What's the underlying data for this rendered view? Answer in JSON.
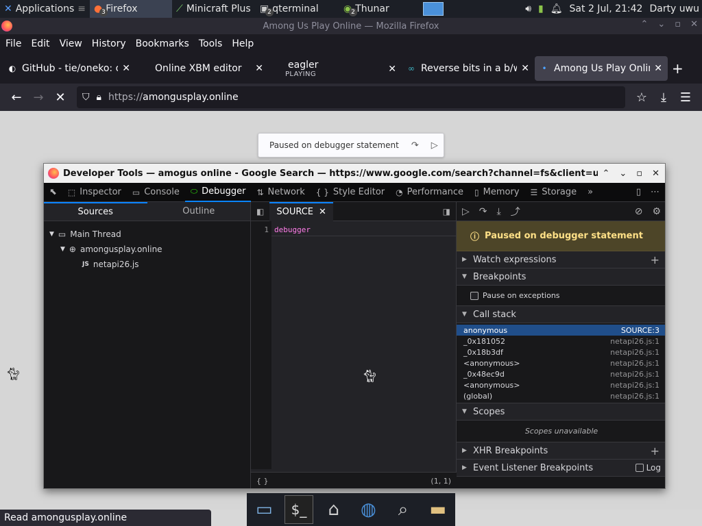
{
  "panel": {
    "apps_label": "Applications",
    "tasks": [
      {
        "label": "Firefox",
        "badge": "3"
      },
      {
        "label": "Minicraft Plus",
        "badge": ""
      },
      {
        "label": "qterminal",
        "badge": "2"
      },
      {
        "label": "Thunar",
        "badge": "2"
      }
    ],
    "clock": "Sat  2 Jul, 21:42",
    "user": "Darty uwu"
  },
  "firefox": {
    "window_title": "Among Us Play Online — Mozilla Firefox",
    "menus": [
      "File",
      "Edit",
      "View",
      "History",
      "Bookmarks",
      "Tools",
      "Help"
    ],
    "tabs": [
      {
        "label": "GitHub - tie/oneko: o",
        "icon": "github-icon",
        "sub": ""
      },
      {
        "label": "Online XBM editor",
        "icon": "",
        "sub": ""
      },
      {
        "label": "eagler",
        "icon": "",
        "sub": "PLAYING"
      },
      {
        "label": "Reverse bits in a b/w",
        "icon": "glasses-icon",
        "sub": ""
      },
      {
        "label": "Among Us Play Online",
        "icon": "dot-icon",
        "sub": ""
      }
    ],
    "url_scheme": "https://",
    "url_host": "amongusplay.online",
    "status_text": "Read amongusplay.online"
  },
  "pause_banner": {
    "text": "Paused on debugger statement"
  },
  "devtools": {
    "title": "Developer Tools — amogus online - Google Search — https://www.google.com/search?channel=fs&client=ubuntu&c",
    "tools": [
      {
        "label": "Inspector",
        "icon": "⬚"
      },
      {
        "label": "Console",
        "icon": "▭"
      },
      {
        "label": "Debugger",
        "icon": "⬭"
      },
      {
        "label": "Network",
        "icon": "⇅"
      },
      {
        "label": "Style Editor",
        "icon": "{ }"
      },
      {
        "label": "Performance",
        "icon": "◔"
      },
      {
        "label": "Memory",
        "icon": "▯"
      },
      {
        "label": "Storage",
        "icon": "☰"
      }
    ],
    "sources_tab": "Sources",
    "outline_tab": "Outline",
    "tree": {
      "thread": "Main Thread",
      "domain": "amongusplay.online",
      "file": "netapi26.js",
      "file_badge": "JS"
    },
    "editor_tab": "SOURCE",
    "line_number": "1",
    "code": "debugger",
    "editor_braces": "{ }",
    "cursor_pos": "(1, 1)",
    "paused_msg": "Paused on debugger statement",
    "sections": {
      "watch": "Watch expressions",
      "breakpoints": "Breakpoints",
      "pause_exceptions": "Pause on exceptions",
      "call_stack": "Call stack",
      "scopes": "Scopes",
      "scopes_empty": "Scopes unavailable",
      "xhr": "XHR Breakpoints",
      "event": "Event Listener Breakpoints",
      "log": "Log"
    },
    "frames": [
      {
        "name": "anonymous",
        "loc": "SOURCE:3"
      },
      {
        "name": "_0x181052",
        "loc": "netapi26.js:1"
      },
      {
        "name": "_0x18b3df",
        "loc": "netapi26.js:1"
      },
      {
        "name": "<anonymous>",
        "loc": "netapi26.js:1"
      },
      {
        "name": "_0x48ec9d",
        "loc": "netapi26.js:1"
      },
      {
        "name": "<anonymous>",
        "loc": "netapi26.js:1"
      },
      {
        "name": "(global)",
        "loc": "netapi26.js:1"
      }
    ]
  },
  "colors": {
    "accent": "#0a84ff",
    "paused_bg": "#4d4528",
    "paused_fg": "#ffe087",
    "selected_frame": "#204e8a"
  }
}
